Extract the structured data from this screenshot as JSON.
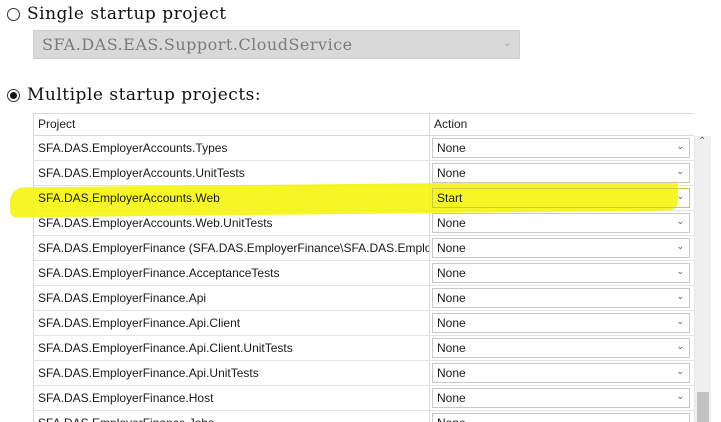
{
  "startup": {
    "single_label": "Single startup project",
    "single_selected_project": "SFA.DAS.EAS.Support.CloudService",
    "multiple_label": "Multiple startup projects:"
  },
  "grid": {
    "headers": {
      "project": "Project",
      "action": "Action"
    },
    "rows": [
      {
        "project": "SFA.DAS.EmployerAccounts.Types",
        "action": "None"
      },
      {
        "project": "SFA.DAS.EmployerAccounts.UnitTests",
        "action": "None"
      },
      {
        "project": "SFA.DAS.EmployerAccounts.Web",
        "action": "Start"
      },
      {
        "project": "SFA.DAS.EmployerAccounts.Web.UnitTests",
        "action": "None"
      },
      {
        "project": "SFA.DAS.EmployerFinance (SFA.DAS.EmployerFinance\\SFA.DAS.Employe...",
        "action": "None"
      },
      {
        "project": "SFA.DAS.EmployerFinance.AcceptanceTests",
        "action": "None"
      },
      {
        "project": "SFA.DAS.EmployerFinance.Api",
        "action": "None"
      },
      {
        "project": "SFA.DAS.EmployerFinance.Api.Client",
        "action": "None"
      },
      {
        "project": "SFA.DAS.EmployerFinance.Api.Client.UnitTests",
        "action": "None"
      },
      {
        "project": "SFA.DAS.EmployerFinance.Api.UnitTests",
        "action": "None"
      },
      {
        "project": "SFA.DAS.EmployerFinance.Host",
        "action": "None"
      },
      {
        "project": "SFA.DAS.EmployerFinance.Jobs",
        "action": "None"
      }
    ]
  },
  "colors": {
    "highlight": "#f5f500",
    "disabled_bg": "#d9d9d9"
  }
}
